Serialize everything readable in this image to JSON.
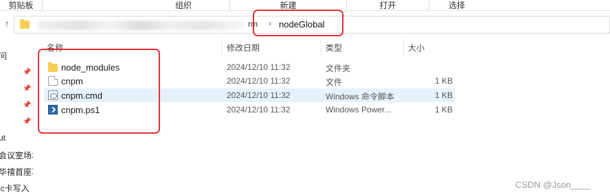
{
  "ribbon": {
    "groups": [
      "剪贴板",
      "组织",
      "新建",
      "打开",
      "选择"
    ]
  },
  "address_bar": {
    "previous_segment": "rm",
    "separator": "›",
    "current_segment": "nodeGlobal"
  },
  "nav_pane": {
    "items": [
      "问",
      "ut",
      "会议室场地",
      "华禧首座项",
      "ic卡写入"
    ]
  },
  "columns": [
    "名称",
    "修改日期",
    "类型",
    "大小"
  ],
  "files": [
    {
      "name": "node_modules",
      "date": "2024/12/10 11:32",
      "type": "文件夹",
      "size": "",
      "icon": "folder-icon"
    },
    {
      "name": "cnpm",
      "date": "2024/12/10 11:32",
      "type": "文件",
      "size": "1 KB",
      "icon": "file-icon"
    },
    {
      "name": "cnpm.cmd",
      "date": "2024/12/10 11:32",
      "type": "Windows 命令脚本",
      "size": "1 KB",
      "icon": "cmd-script-icon"
    },
    {
      "name": "cnpm.ps1",
      "date": "2024/12/10 11:32",
      "type": "Windows Power...",
      "size": "1 KB",
      "icon": "powershell-script-icon"
    }
  ],
  "watermark": "CSDN @Json____",
  "colors": {
    "highlight": "#e03030",
    "folder": "#f6cf52",
    "selection": "#e5f1fb"
  }
}
